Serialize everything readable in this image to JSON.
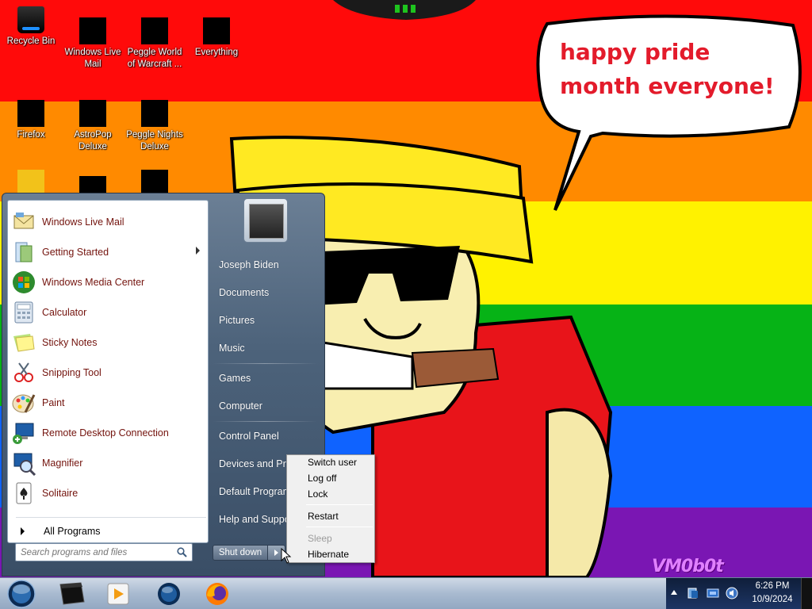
{
  "wallpaper": {
    "speech_bubble": "happy pride month everyone!",
    "watermark": "VM0b0t"
  },
  "desktop_icons": [
    {
      "label": "Recycle Bin"
    },
    {
      "label": "Windows Live Mail"
    },
    {
      "label": "Peggle World of Warcraft ..."
    },
    {
      "label": "Everything"
    },
    {
      "label": "Firefox"
    },
    {
      "label": "AstroPop Deluxe"
    },
    {
      "label": "Peggle Nights Deluxe"
    }
  ],
  "start_menu": {
    "programs": [
      {
        "label": "Windows Live Mail",
        "icon": "mail-icon"
      },
      {
        "label": "Getting Started",
        "icon": "getting-started-icon",
        "has_submenu": true
      },
      {
        "label": "Windows Media Center",
        "icon": "media-center-icon"
      },
      {
        "label": "Calculator",
        "icon": "calculator-icon"
      },
      {
        "label": "Sticky Notes",
        "icon": "sticky-notes-icon"
      },
      {
        "label": "Snipping Tool",
        "icon": "snipping-tool-icon"
      },
      {
        "label": "Paint",
        "icon": "paint-icon"
      },
      {
        "label": "Remote Desktop Connection",
        "icon": "remote-desktop-icon"
      },
      {
        "label": "Magnifier",
        "icon": "magnifier-icon"
      },
      {
        "label": "Solitaire",
        "icon": "solitaire-icon"
      }
    ],
    "all_programs": "All Programs",
    "search_placeholder": "Search programs and files",
    "right_links": [
      "Joseph Biden",
      "Documents",
      "Pictures",
      "Music",
      "Games",
      "Computer",
      "Control Panel",
      "Devices and Printers",
      "Default Programs",
      "Help and Support"
    ],
    "shutdown_label": "Shut down",
    "power_menu": {
      "items": [
        "Switch user",
        "Log off",
        "Lock",
        "Restart",
        "Sleep",
        "Hibernate"
      ],
      "disabled": [
        "Sleep"
      ]
    }
  },
  "taskbar": {
    "clock_time": "6:26 PM",
    "clock_date": "10/9/2024"
  },
  "colors": {
    "pride_red": "#ff0a0a",
    "pride_orange": "#ff8a00",
    "pride_yellow": "#fff200",
    "pride_green": "#06b316",
    "pride_blue": "#0f63ff",
    "pride_purple": "#7a16b3",
    "bubble_text": "#e31b2b"
  }
}
